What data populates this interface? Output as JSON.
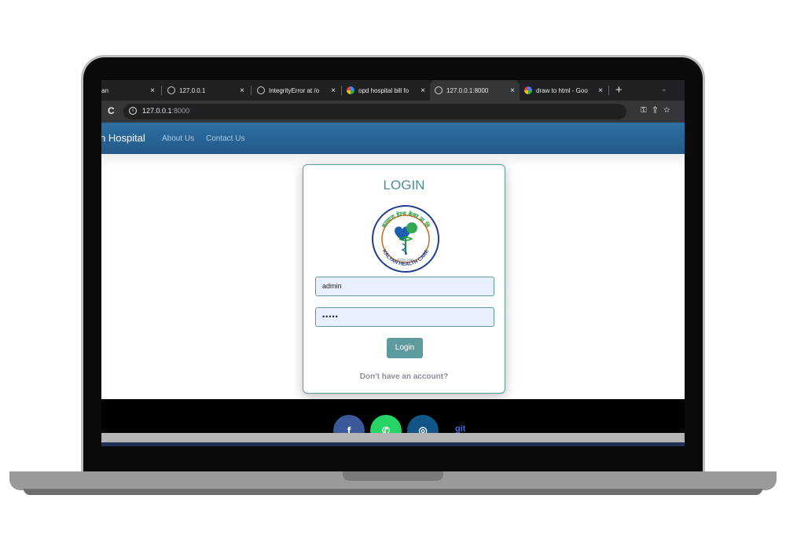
{
  "browser": {
    "tabs": [
      {
        "label": "an",
        "icon": "none"
      },
      {
        "label": "127.0.0.1",
        "icon": "globe-icon"
      },
      {
        "label": "IntegrityError at /o",
        "icon": "globe-icon"
      },
      {
        "label": "opd hospital bill fo",
        "icon": "google-icon"
      },
      {
        "label": "127.0.0.1:8000",
        "icon": "globe-icon",
        "active": true
      },
      {
        "label": "draw to html - Goo",
        "icon": "google-icon"
      }
    ],
    "close_glyph": "×",
    "new_tab": "+",
    "tab_menu": "⌄",
    "url_host": "127.0.0.1",
    "url_port": ":8000"
  },
  "site": {
    "brand": "n Hospital",
    "nav": {
      "about": "About Us",
      "contact": "Contact Us"
    }
  },
  "login": {
    "title": "LOGIN",
    "username_value": "admin",
    "password_value": "•••••",
    "button": "Login",
    "signup_text": "Don't have an account?"
  },
  "logo": {
    "top_text": "कल्याण हेल्थ केयर प्रा लि",
    "bottom_text": "KALYAN HEALTH CARE",
    "estd": "ESTD 2080"
  },
  "footer": {
    "facebook": "f",
    "whatsapp": "✆",
    "instagram": "◎",
    "git_label": "git"
  },
  "colors": {
    "accent": "#5e9b9f",
    "navbar": "#2d6fa4",
    "facebook": "#3b5998",
    "whatsapp": "#25d366",
    "instagram": "#125688"
  }
}
